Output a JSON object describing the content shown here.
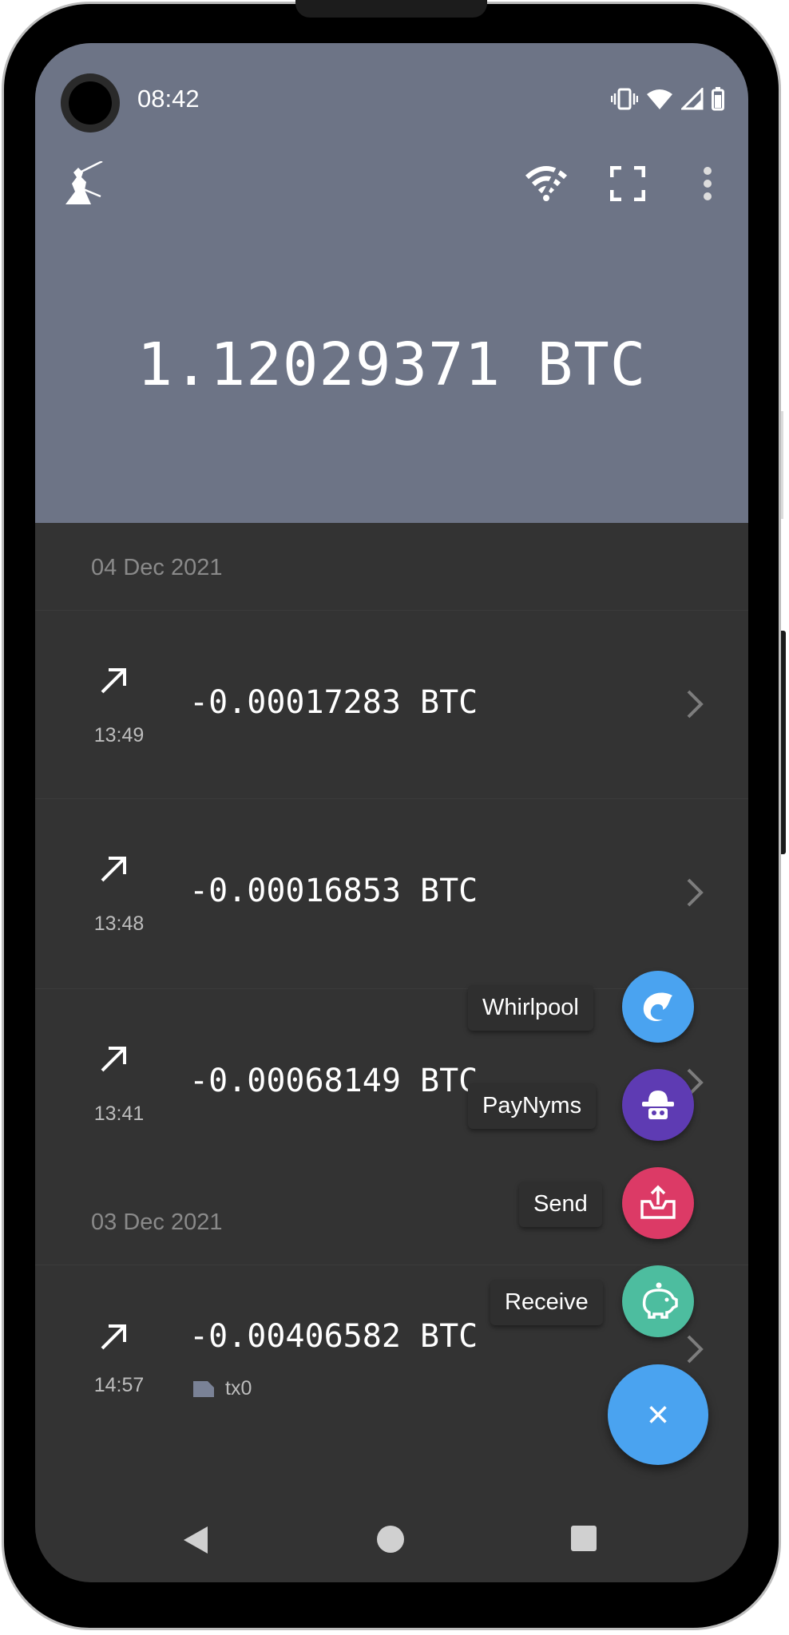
{
  "status_bar": {
    "time": "08:42"
  },
  "wallet": {
    "balance": "1.12029371 BTC"
  },
  "transactions": [
    {
      "date": "04 Dec 2021",
      "items": [
        {
          "time": "13:49",
          "amount": "-0.00017283 BTC"
        },
        {
          "time": "13:48",
          "amount": "-0.00016853 BTC"
        },
        {
          "time": "13:41",
          "amount": "-0.00068149 BTC"
        }
      ]
    },
    {
      "date": "03 Dec 2021",
      "items": [
        {
          "time": "14:57",
          "amount": "-0.00406582 BTC",
          "tag": "tx0"
        }
      ]
    }
  ],
  "fab_menu": {
    "whirlpool": "Whirlpool",
    "paynyms": "PayNyms",
    "send": "Send",
    "receive": "Receive",
    "close": "×"
  },
  "colors": {
    "header": "#6d7486",
    "background": "#333333",
    "whirlpool": "#4aa3f0",
    "paynyms": "#5e3bb3",
    "send": "#dc3a66",
    "receive": "#4dbd9f"
  }
}
